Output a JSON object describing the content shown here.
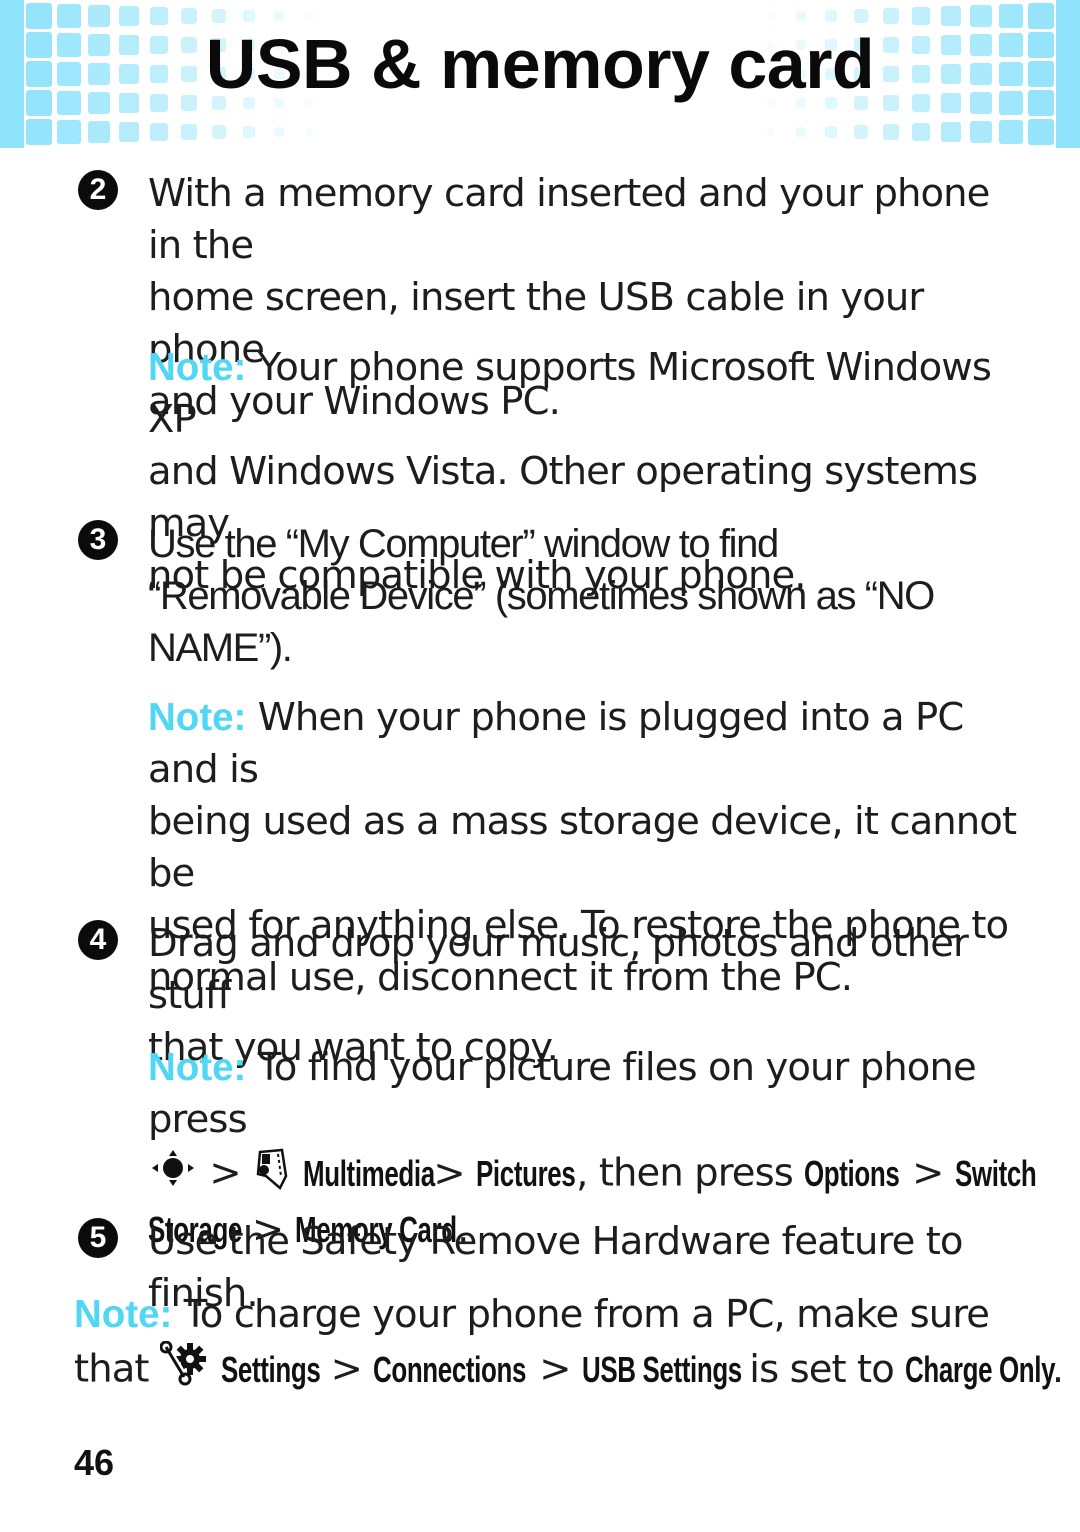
{
  "header": {
    "title": "USB & memory card",
    "pattern_color": "#8fe3fb"
  },
  "accent_color": "#4fd7f3",
  "steps": [
    {
      "number": "2",
      "text": "With a memory card inserted and your phone in the home screen, insert the USB cable in your phone and your Windows PC.",
      "lines": [
        "With a memory card inserted and your phone in the",
        "home screen, insert the USB cable in your phone",
        "and your Windows PC."
      ],
      "note": {
        "label": "Note:",
        "lines": [
          " Your phone supports Microsoft Windows XP",
          "and Windows Vista. Other operating systems may",
          "not be compatible with your phone."
        ]
      }
    },
    {
      "number": "3",
      "lines": [
        "Use the “My Computer” window to find",
        "“Removable Device” (sometimes shown as “NO",
        "NAME”)."
      ],
      "note": {
        "label": "Note:",
        "lines": [
          " When your phone is plugged into a PC and is",
          "being used as a mass storage device, it cannot be",
          "used for anything else. To restore the phone to",
          "normal use, disconnect it from the PC."
        ]
      }
    },
    {
      "number": "4",
      "lines": [
        "Drag and drop your music, photos and other stuff",
        "that you want to copy."
      ],
      "note": {
        "label": "Note:",
        "line1": " To find your picture files on your phone press",
        "sep": ">",
        "menu_multimedia": "Multimedia",
        "menu_pictures": "Pictures",
        "comma": ",",
        "then_press": " then press ",
        "menu_options": "Options",
        "menu_switch": "Switch",
        "menu_storage": "Storage",
        "menu_memory_card": "Memory Card",
        "period": "."
      }
    },
    {
      "number": "5",
      "lines": [
        "Use the Safety Remove Hardware feature to finish."
      ]
    }
  ],
  "footer_note": {
    "label": "Note:",
    "line1": " To charge your phone from a PC, make sure",
    "that": "that",
    "menu_settings": "Settings",
    "sep": ">",
    "menu_connections": "Connections",
    "menu_usb_settings": "USB Settings",
    "is_set_to": " is set to ",
    "menu_charge_only": "Charge Only",
    "period": "."
  },
  "page_number": "46",
  "icons": {
    "nav_key": "nav-key-icon",
    "multimedia": "multimedia-filmstrip-icon",
    "settings": "settings-wrench-gear-icon"
  }
}
